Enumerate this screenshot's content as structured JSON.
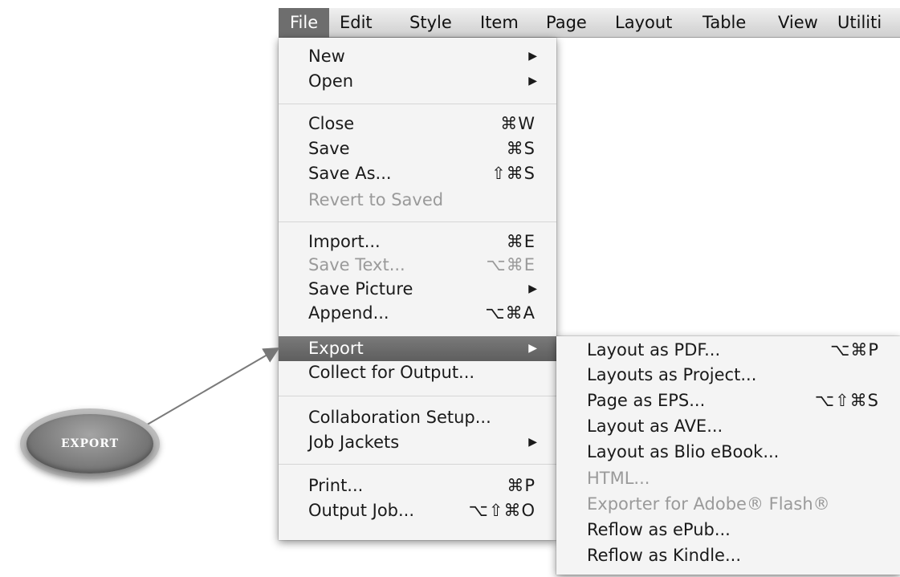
{
  "menubar": {
    "items": [
      "File",
      "Edit",
      "Style",
      "Item",
      "Page",
      "Layout",
      "Table",
      "View",
      "Utiliti"
    ]
  },
  "file_menu": {
    "items": [
      {
        "label": "New",
        "submenu": true
      },
      {
        "label": "Open",
        "submenu": true
      },
      {
        "label": "Close",
        "shortcut": "⌘W"
      },
      {
        "label": "Save",
        "shortcut": "⌘S"
      },
      {
        "label": "Save As...",
        "shortcut": "⇧⌘S"
      },
      {
        "label": "Revert to Saved",
        "disabled": true
      },
      {
        "label": "Import...",
        "shortcut": "⌘E"
      },
      {
        "label": "Save Text...",
        "shortcut": "⌥⌘E",
        "disabled": true
      },
      {
        "label": "Save Picture",
        "submenu": true
      },
      {
        "label": "Append...",
        "shortcut": "⌥⌘A"
      },
      {
        "label": "Export",
        "submenu": true,
        "highlighted": true
      },
      {
        "label": "Collect for Output..."
      },
      {
        "label": "Collaboration Setup..."
      },
      {
        "label": "Job Jackets",
        "submenu": true
      },
      {
        "label": "Print...",
        "shortcut": "⌘P"
      },
      {
        "label": "Output Job...",
        "shortcut": "⌥⇧⌘O"
      }
    ]
  },
  "export_submenu": {
    "items": [
      {
        "label": "Layout as PDF...",
        "shortcut": "⌥⌘P"
      },
      {
        "label": "Layouts as Project..."
      },
      {
        "label": "Page as EPS...",
        "shortcut": "⌥⇧⌘S"
      },
      {
        "label": "Layout as AVE..."
      },
      {
        "label": "Layout as Blio eBook..."
      },
      {
        "label": "HTML...",
        "disabled": true
      },
      {
        "label": "Exporter for Adobe® Flash®",
        "disabled": true
      },
      {
        "label": "Reflow as ePub..."
      },
      {
        "label": "Reflow as Kindle..."
      }
    ]
  },
  "callout": {
    "label": "EXPORT"
  },
  "icons": {
    "submenu_arrow": "▶"
  },
  "colors": {
    "highlight": "#6e6e6e",
    "disabled": "#9a9a9a",
    "menu_bg": "#f4f4f4"
  }
}
